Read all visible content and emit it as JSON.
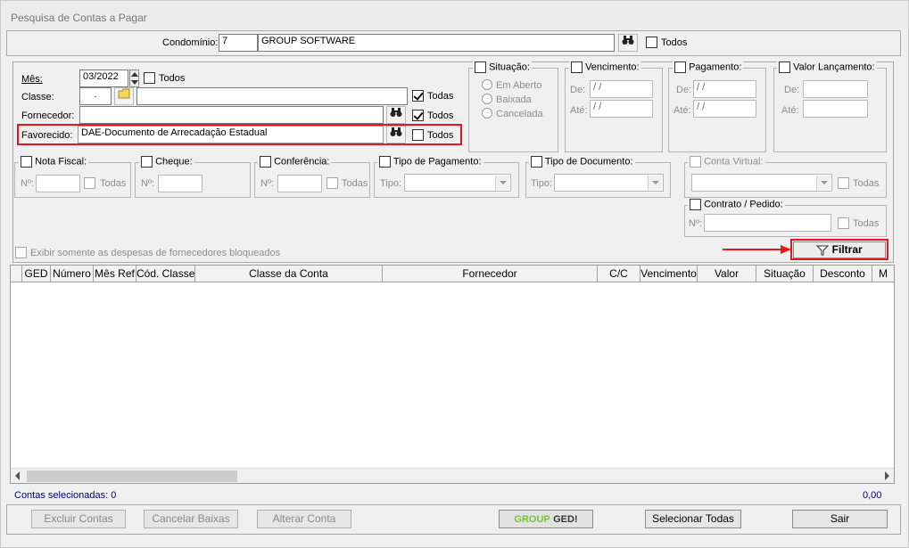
{
  "window": {
    "title": "Pesquisa de Contas a Pagar"
  },
  "header": {
    "condominio_label": "Condomínio:",
    "condominio_code": "7",
    "condominio_name": "GROUP SOFTWARE",
    "todos_label": "Todos"
  },
  "filters": {
    "mes_label": "Mês:",
    "mes_value": "03/2022",
    "mes_todos": "Todos",
    "classe_label": "Classe:",
    "classe_code": ".",
    "classe_todos": "Todas",
    "fornecedor_label": "Fornecedor:",
    "fornecedor_todos": "Todos",
    "favorecido_label": "Favorecido:",
    "favorecido_value": "DAE-Documento de Arrecadação Estadual",
    "favorecido_todos": "Todos"
  },
  "situacao": {
    "title": "Situação:",
    "options": [
      "Em Aberto",
      "Baixada",
      "Cancelada"
    ]
  },
  "vencimento": {
    "title": "Vencimento:",
    "de_label": "De:",
    "ate_label": "Até:",
    "de_value": " / /",
    "ate_value": " / /"
  },
  "pagamento": {
    "title": "Pagamento:",
    "de_label": "De:",
    "ate_label": "Até:",
    "de_value": " / /",
    "ate_value": " / /"
  },
  "valor": {
    "title": "Valor Lançamento:",
    "de_label": "De:",
    "ate_label": "Até:"
  },
  "nota_fiscal": {
    "title": "Nota Fiscal:",
    "no_label": "Nº:",
    "todas": "Todas"
  },
  "cheque": {
    "title": "Cheque:",
    "no_label": "Nº:"
  },
  "conferencia": {
    "title": "Conferência:",
    "no_label": "Nº:",
    "todas": "Todas"
  },
  "tipo_pagamento": {
    "title": "Tipo de Pagamento:",
    "tipo_label": "Tipo:"
  },
  "tipo_documento": {
    "title": "Tipo de Documento:",
    "tipo_label": "Tipo:"
  },
  "conta_virtual": {
    "title": "Conta Virtual:",
    "todas": "Todas"
  },
  "contrato": {
    "title": "Contrato / Pedido:",
    "no_label": "Nº:",
    "todas": "Todas"
  },
  "bloqueados_label": "Exibir somente as despesas de fornecedores bloqueados",
  "filtrar_label": "Filtrar",
  "grid": {
    "columns": [
      "GED",
      "Número",
      "Mês Ref",
      "Cód. Classe",
      "Classe da Conta",
      "Fornecedor",
      "C/C",
      "Vencimento",
      "Valor",
      "Situação",
      "Desconto",
      "M"
    ]
  },
  "footer": {
    "selecionadas_label": "Contas selecionadas: 0",
    "total_value": "0,00",
    "excluir": "Excluir Contas",
    "cancelar": "Cancelar Baixas",
    "alterar": "Alterar Conta",
    "ged_logo_a": "GROUP",
    "ged_logo_b": "GED!",
    "selecionar": "Selecionar Todas",
    "sair": "Sair"
  },
  "colors": {
    "highlight_red": "#e8161a",
    "total_blue": "#00007f"
  }
}
